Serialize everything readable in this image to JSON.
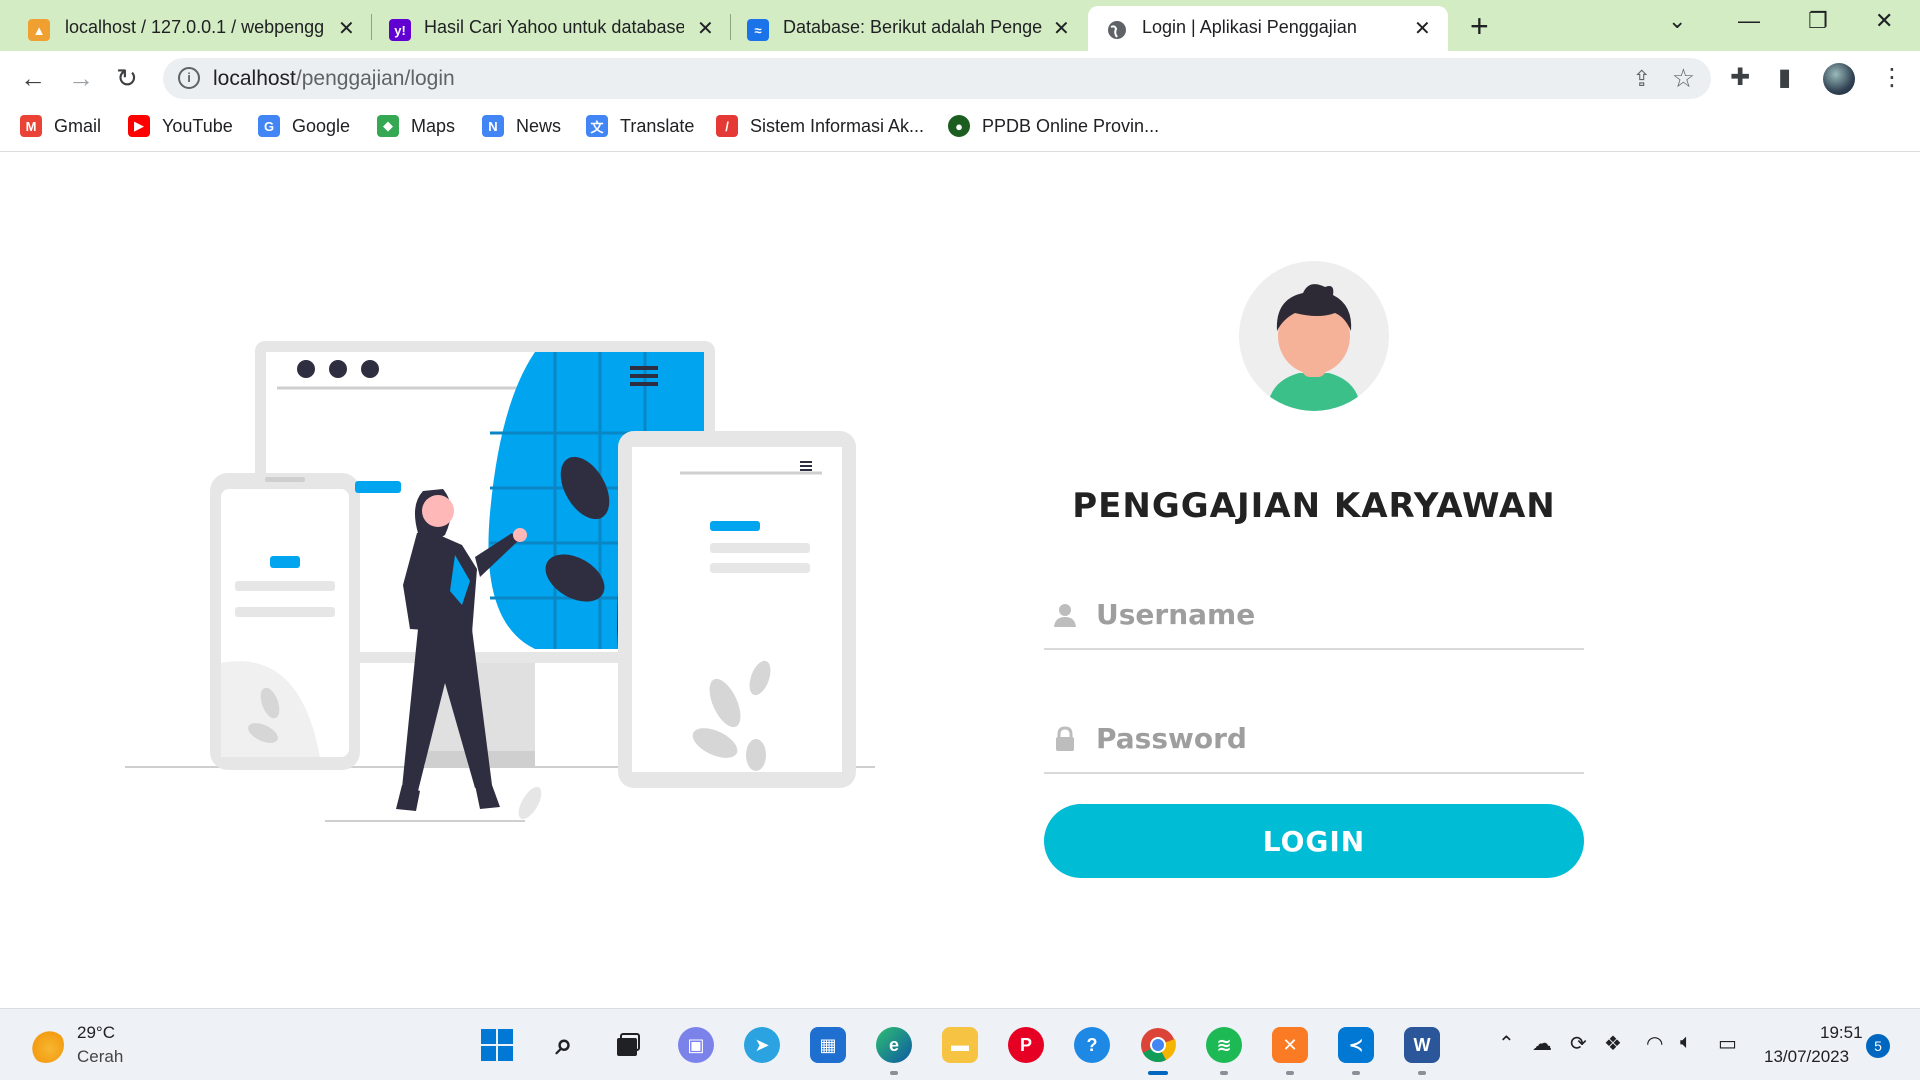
{
  "browser": {
    "tabs": [
      {
        "title": "localhost / 127.0.0.1 / webpengg",
        "icon": "phpmyadmin-icon"
      },
      {
        "title": "Hasil Cari Yahoo untuk database",
        "icon": "yahoo-icon"
      },
      {
        "title": "Database: Berikut adalah Pengert",
        "icon": "site-icon"
      },
      {
        "title": "Login | Aplikasi Penggajian",
        "icon": "globe-icon"
      }
    ],
    "url_host": "localhost",
    "url_path": "/penggajian/login",
    "bookmarks": [
      {
        "label": "Gmail",
        "icon": "gmail-icon",
        "color": "#EA4335"
      },
      {
        "label": "YouTube",
        "icon": "youtube-icon",
        "color": "#FF0000"
      },
      {
        "label": "Google",
        "icon": "google-icon",
        "color": "#4285F4"
      },
      {
        "label": "Maps",
        "icon": "maps-icon",
        "color": "#34A853"
      },
      {
        "label": "News",
        "icon": "news-icon",
        "color": "#4285F4"
      },
      {
        "label": "Translate",
        "icon": "translate-icon",
        "color": "#4285F4"
      },
      {
        "label": "Sistem Informasi Ak...",
        "icon": "siakad-icon",
        "color": "#E53935"
      },
      {
        "label": "PPDB Online Provin...",
        "icon": "ppdb-icon",
        "color": "#1B5E20"
      }
    ]
  },
  "login": {
    "title": "PENGGAJIAN KARYAWAN",
    "username_placeholder": "Username",
    "password_placeholder": "Password",
    "button_label": "LOGIN",
    "accent": "#00BCD4"
  },
  "taskbar": {
    "weather_temp": "29°C",
    "weather_desc": "Cerah",
    "time": "19:51",
    "date": "13/07/2023",
    "notification_count": "5",
    "apps": [
      "windows-start-icon",
      "search-icon",
      "task-view-icon",
      "teams-icon",
      "telegram-icon",
      "store-icon",
      "edge-icon",
      "file-explorer-icon",
      "pinterest-icon",
      "help-icon",
      "chrome-icon",
      "spotify-icon",
      "xampp-icon",
      "vscode-icon",
      "word-icon"
    ]
  }
}
